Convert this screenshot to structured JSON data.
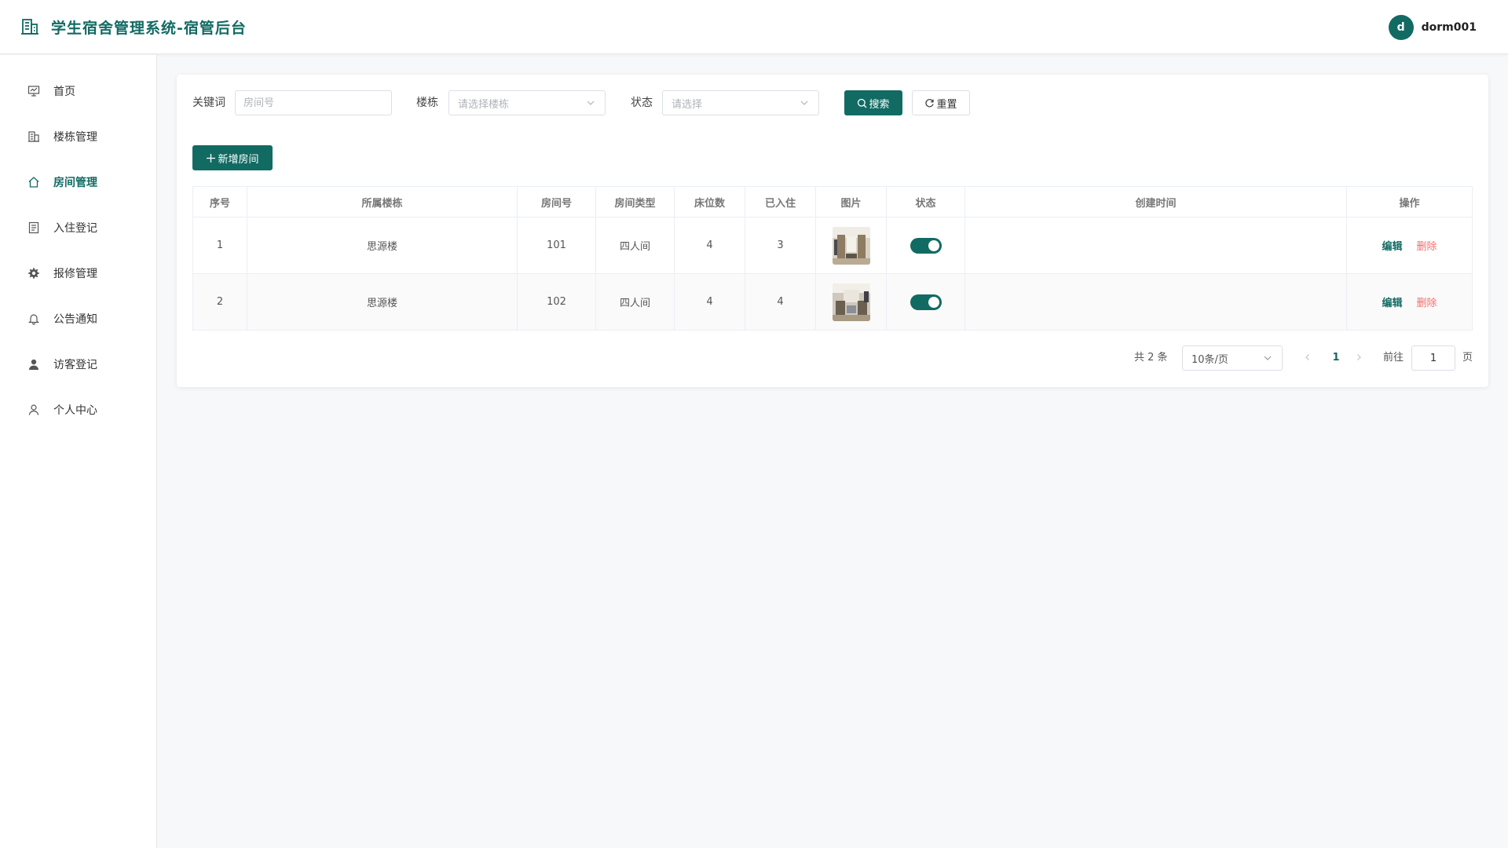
{
  "header": {
    "title": "学生宿舍管理系统-宿管后台",
    "brand_icon": "building-icon",
    "user": {
      "avatar_letter": "d",
      "name": "dorm001"
    }
  },
  "sidebar": {
    "items": [
      {
        "label": "首页",
        "icon": "monitor-chart-icon",
        "active": false
      },
      {
        "label": "楼栋管理",
        "icon": "building-icon",
        "active": false
      },
      {
        "label": "房间管理",
        "icon": "house-icon",
        "active": true
      },
      {
        "label": "入住登记",
        "icon": "document-icon",
        "active": false
      },
      {
        "label": "报修管理",
        "icon": "gear-icon",
        "active": false
      },
      {
        "label": "公告通知",
        "icon": "bell-icon",
        "active": false
      },
      {
        "label": "访客登记",
        "icon": "user-filled-icon",
        "active": false
      },
      {
        "label": "个人中心",
        "icon": "user-outline-icon",
        "active": false
      }
    ]
  },
  "filters": {
    "keyword_label": "关键词",
    "keyword_placeholder": "房间号",
    "building_label": "楼栋",
    "building_placeholder": "请选择楼栋",
    "status_label": "状态",
    "status_placeholder": "请选择",
    "search_label": "搜索",
    "reset_label": "重置"
  },
  "toolbar": {
    "add_label": "新增房间"
  },
  "table": {
    "columns": [
      "序号",
      "所属楼栋",
      "房间号",
      "房间类型",
      "床位数",
      "已入住",
      "图片",
      "状态",
      "创建时间",
      "操作"
    ],
    "rows": [
      {
        "index": "1",
        "building": "思源楼",
        "room": "101",
        "type": "四人间",
        "beds": "4",
        "occupied": "3",
        "status_on": true,
        "created": ""
      },
      {
        "index": "2",
        "building": "思源楼",
        "room": "102",
        "type": "四人间",
        "beds": "4",
        "occupied": "4",
        "status_on": true,
        "created": ""
      }
    ],
    "edit_label": "编辑",
    "delete_label": "删除"
  },
  "pagination": {
    "total_text": "共 2 条",
    "page_size": "10条/页",
    "current_page": "1",
    "goto_label": "前往",
    "goto_value": "1",
    "page_suffix": "页"
  },
  "colors": {
    "primary": "#116b63",
    "danger": "#f56c6c",
    "background": "#f7f8fa"
  }
}
